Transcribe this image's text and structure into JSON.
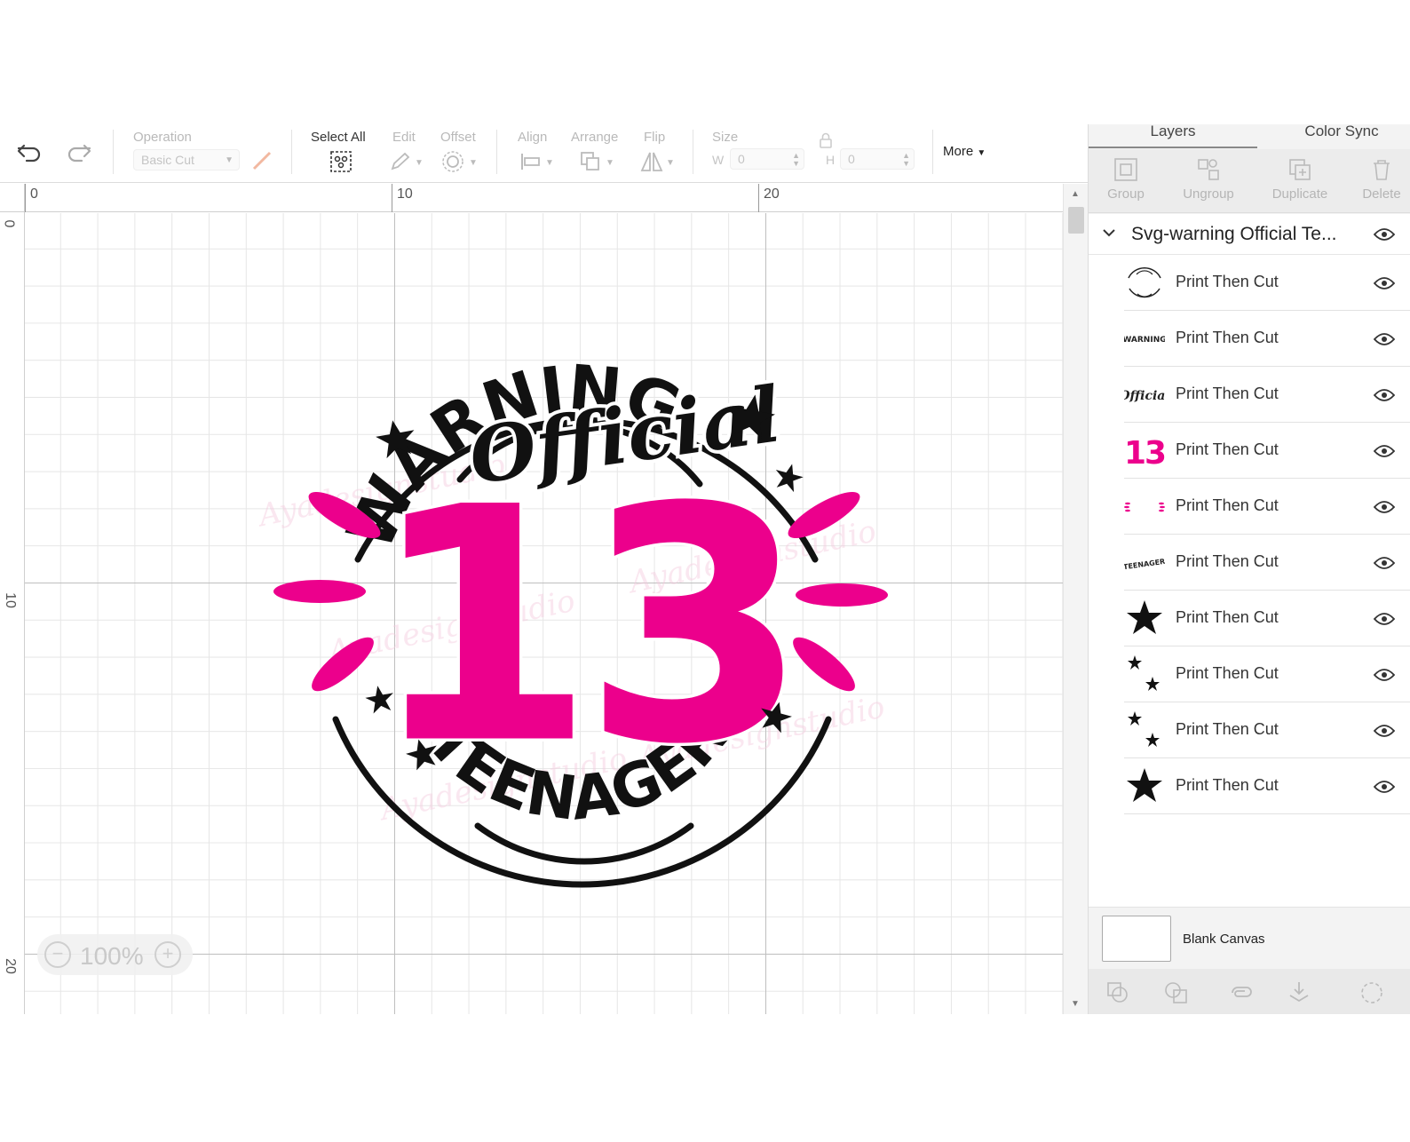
{
  "toolbar": {
    "operation_label": "Operation",
    "operation_value": "Basic Cut",
    "select_all_label": "Select All",
    "edit_label": "Edit",
    "offset_label": "Offset",
    "align_label": "Align",
    "arrange_label": "Arrange",
    "flip_label": "Flip",
    "size_label": "Size",
    "w_label": "W",
    "w_value": "0",
    "h_label": "H",
    "h_value": "0",
    "more_label": "More"
  },
  "ruler": {
    "top": [
      "0",
      "10",
      "20"
    ],
    "left": [
      "0",
      "10",
      "20"
    ]
  },
  "zoom": {
    "value": "100%",
    "minus": "−",
    "plus": "+"
  },
  "panel": {
    "tabs": [
      "Layers",
      "Color Sync"
    ],
    "actions": [
      "Group",
      "Ungroup",
      "Duplicate",
      "Delete"
    ],
    "group_name": "Svg-warning Official Te...",
    "layers": [
      {
        "label": "Print Then Cut",
        "thumb": "circle-arc-icon"
      },
      {
        "label": "Print Then Cut",
        "thumb": "warning-text-icon"
      },
      {
        "label": "Print Then Cut",
        "thumb": "official-script-icon"
      },
      {
        "label": "Print Then Cut",
        "thumb": "number-13-icon"
      },
      {
        "label": "Print Then Cut",
        "thumb": "pink-rays-icon"
      },
      {
        "label": "Print Then Cut",
        "thumb": "teenager-text-icon"
      },
      {
        "label": "Print Then Cut",
        "thumb": "star-icon"
      },
      {
        "label": "Print Then Cut",
        "thumb": "two-stars-icon"
      },
      {
        "label": "Print Then Cut",
        "thumb": "two-stars-icon"
      },
      {
        "label": "Print Then Cut",
        "thumb": "star-icon"
      }
    ],
    "blank_canvas": "Blank Canvas"
  },
  "design": {
    "top_text": "WARNING",
    "script_text": "Official",
    "number": "13",
    "bottom_text": "TEENAGER",
    "watermark": "Ayadesignstudio",
    "colors": {
      "pink": "#EC008C",
      "black": "#111111"
    }
  }
}
